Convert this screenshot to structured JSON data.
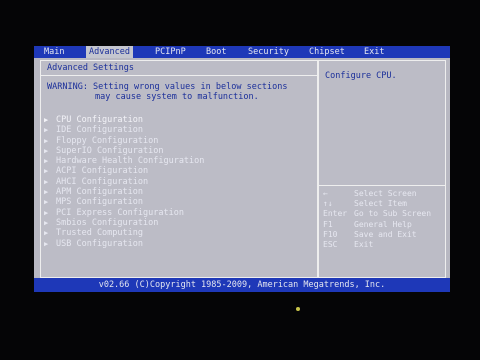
{
  "tabs": [
    "Main",
    "Advanced",
    "PCIPnP",
    "Boot",
    "Security",
    "Chipset",
    "Exit"
  ],
  "active_tab": "Advanced",
  "panel_title": "Advanced Settings",
  "warning": {
    "line1": "WARNING: Setting wrong values in below sections",
    "line2": "may cause system to malfunction."
  },
  "menu_items": [
    {
      "label": "CPU Configuration",
      "selected": true
    },
    {
      "label": "IDE Configuration",
      "selected": false
    },
    {
      "label": "Floppy Configuration",
      "selected": false
    },
    {
      "label": "SuperIO Configuration",
      "selected": false
    },
    {
      "label": "Hardware Health Configuration",
      "selected": false
    },
    {
      "label": "ACPI Configuration",
      "selected": false
    },
    {
      "label": "AHCI Configuration",
      "selected": false
    },
    {
      "label": "APM Configuration",
      "selected": false
    },
    {
      "label": "MPS Configuration",
      "selected": false
    },
    {
      "label": "PCI Express Configuration",
      "selected": false
    },
    {
      "label": "Smbios Configuration",
      "selected": false
    },
    {
      "label": "Trusted Computing",
      "selected": false
    },
    {
      "label": "USB Configuration",
      "selected": false
    }
  ],
  "help_text": "Configure CPU.",
  "key_legend": [
    {
      "key": "←",
      "action": "Select Screen"
    },
    {
      "key": "↑↓",
      "action": "Select Item"
    },
    {
      "key": "Enter",
      "action": "Go to Sub Screen"
    },
    {
      "key": "F1",
      "action": "General Help"
    },
    {
      "key": "F10",
      "action": "Save and Exit"
    },
    {
      "key": "ESC",
      "action": "Exit"
    }
  ],
  "footer": "v02.66 (C)Copyright 1985-2009, American Megatrends, Inc.",
  "colors": {
    "bar_blue": "#1e38b8",
    "panel_gray": "#bcbcc6",
    "title_blue": "#1b2f9a",
    "item_white": "#e6e7f0"
  }
}
